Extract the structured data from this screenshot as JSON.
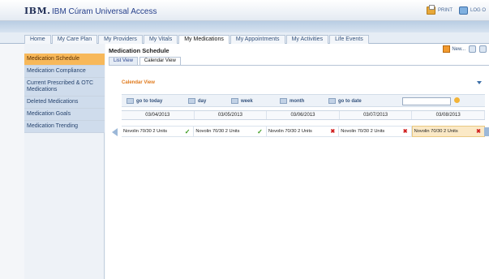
{
  "banner": {
    "logo": "IBM.",
    "app_title": "IBM Cúram Universal Access",
    "print_label": "PRINT",
    "logout_label": "LOG O"
  },
  "tabs": [
    "Home",
    "My Care Plan",
    "My Providers",
    "My Vitals",
    "My Medications",
    "My Appointments",
    "My Activities",
    "Life Events"
  ],
  "active_tab": "My Medications",
  "sidenav": {
    "items": [
      "Medication Schedule",
      "Medication Compliance",
      "Current Prescribed & OTC Medications",
      "Deleted Medications",
      "Medication Goals",
      "Medication Trending"
    ],
    "active": "Medication Schedule"
  },
  "main": {
    "page_title": "Medication Schedule",
    "new_label": "New...",
    "subtabs": [
      "List View",
      "Calendar View"
    ],
    "active_subtab": "Calendar View",
    "calendar_title": "Calendar View",
    "toolbar": {
      "today": "go to today",
      "day": "day",
      "week": "week",
      "month": "month",
      "go_to_date": "go to date",
      "date_value": ""
    },
    "dates": [
      "03/04/2013",
      "03/05/2013",
      "03/06/2013",
      "03/07/2013",
      "03/08/2013"
    ],
    "entries": [
      {
        "text": "Novolin 70/30 2 Units",
        "status": "taken"
      },
      {
        "text": "Novolin 70/30 2 Units",
        "status": "taken"
      },
      {
        "text": "Novolin 70/30 2 Units",
        "status": "missed"
      },
      {
        "text": "Novolin 70/30 2 Units",
        "status": "missed"
      },
      {
        "text": "Novolin 70/30 2 Units",
        "status": "missed"
      }
    ]
  },
  "colors": {
    "accent": "#f7b85a",
    "link": "#27408b",
    "taken": "#3c9a1e",
    "missed": "#d01e1e"
  }
}
